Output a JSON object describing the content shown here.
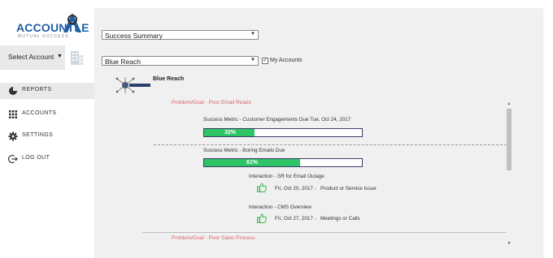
{
  "brand": {
    "name": "ACCOUNTLE",
    "tagline": "MUTUAL SUCCESS"
  },
  "account_selector": {
    "label": "Select Account"
  },
  "nav": [
    {
      "label": "REPORTS",
      "icon": "pie-chart-icon",
      "active": true
    },
    {
      "label": "ACCOUNTS",
      "icon": "grid-icon",
      "active": false
    },
    {
      "label": "SETTINGS",
      "icon": "gear-icon",
      "active": false
    },
    {
      "label": "LOG OUT",
      "icon": "logout-icon",
      "active": false
    }
  ],
  "report_select": {
    "value": "Success Summary"
  },
  "account_select": {
    "value": "Blue Reach"
  },
  "my_accounts": {
    "label": "My Accounts",
    "checked": true
  },
  "account": {
    "name": "Blue Reach",
    "logo_text": "BlueReach"
  },
  "goals": [
    {
      "label": "Problem/Goal - Poor Email Reads",
      "metrics": [
        {
          "title": "Success Metric - Customer Engagements  Due  Tue, Oct 24, 2017",
          "progress": 32,
          "progress_label": "32%"
        },
        {
          "title": "Success Metric - Boring Emails  Due",
          "progress": 61,
          "progress_label": "61%"
        }
      ],
      "interactions": [
        {
          "title": "Interaction - SR for Email Outage",
          "date": "Fri, Oct 20, 2017",
          "separator": "-",
          "type": "Product or Service Issue"
        },
        {
          "title": "Interaction - CMS Overview",
          "date": "Fri, Oct 27, 2017",
          "separator": "-",
          "type": "Meetings or Calls"
        }
      ]
    },
    {
      "label": "Problem/Goal - Poor Sales Process"
    }
  ],
  "colors": {
    "progress": "#2fc466",
    "problem": "#e06666",
    "brand": "#1e5fa3",
    "thumb": "#3cb54a"
  }
}
